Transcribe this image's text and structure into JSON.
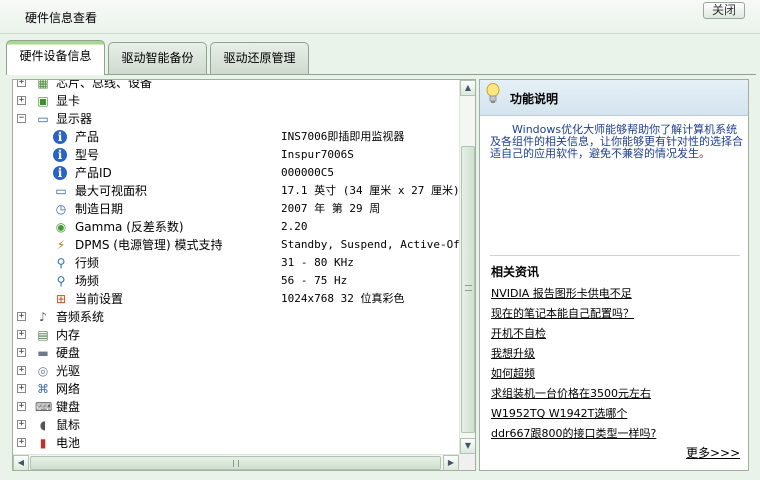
{
  "window": {
    "title": "硬件信息查看",
    "close_label": "关闭"
  },
  "tabs": [
    {
      "label": "硬件设备信息",
      "active": true
    },
    {
      "label": "驱动智能备份",
      "active": false
    },
    {
      "label": "驱动还原管理",
      "active": false
    }
  ],
  "tree": {
    "rows": [
      {
        "kind": "group",
        "label": "芯片、总线、设备",
        "expander": "+",
        "icon": "chip-icon",
        "glyph": "▦",
        "color": "#4a8a3a",
        "name": "tree-node-chipset"
      },
      {
        "kind": "group",
        "label": "显卡",
        "expander": "+",
        "icon": "graphics-card-icon",
        "glyph": "▣",
        "color": "#3f8f2f",
        "name": "tree-node-graphics-card"
      },
      {
        "kind": "group",
        "label": "显示器",
        "expander": "−",
        "icon": "monitor-icon",
        "glyph": "▭",
        "color": "#2d5fa8",
        "name": "tree-node-monitor"
      },
      {
        "kind": "prop",
        "label": "产品",
        "value": "INS7006即插即用监视器",
        "icon": "info-icon",
        "glyph": "i",
        "color": "#2258b8",
        "name": "prop-product"
      },
      {
        "kind": "prop",
        "label": "型号",
        "value": "Inspur7006S",
        "icon": "info-icon",
        "glyph": "i",
        "color": "#2258b8",
        "name": "prop-model"
      },
      {
        "kind": "prop",
        "label": "产品ID",
        "value": "000000C5",
        "icon": "info-icon",
        "glyph": "i",
        "color": "#2258b8",
        "name": "prop-product-id"
      },
      {
        "kind": "prop",
        "label": "最大可视面积",
        "value": "17.1 英寸 (34 厘米 x 27 厘米)",
        "icon": "monitor-icon",
        "glyph": "▭",
        "color": "#2d5fa8",
        "name": "prop-max-visible-area"
      },
      {
        "kind": "prop",
        "label": "制造日期",
        "value": "2007 年 第 29 周",
        "icon": "clock-icon",
        "glyph": "◷",
        "color": "#2d5fa8",
        "name": "prop-manufacture-date"
      },
      {
        "kind": "prop",
        "label": "Gamma (反差系数)",
        "value": "2.20",
        "icon": "gamma-icon",
        "glyph": "◉",
        "color": "#4a9a3a",
        "name": "prop-gamma"
      },
      {
        "kind": "prop",
        "label": "DPMS (电源管理) 模式支持",
        "value": "Standby, Suspend, Active-Off",
        "icon": "power-management-icon",
        "glyph": "⚡",
        "color": "#b07a20",
        "name": "prop-dpms"
      },
      {
        "kind": "prop",
        "label": "行频",
        "value": "31 - 80 KHz",
        "icon": "search-icon",
        "glyph": "⚲",
        "color": "#2a6fc0",
        "name": "prop-horizontal-frequency"
      },
      {
        "kind": "prop",
        "label": "场频",
        "value": "56 - 75 Hz",
        "icon": "search-icon",
        "glyph": "⚲",
        "color": "#2a6fc0",
        "name": "prop-vertical-frequency"
      },
      {
        "kind": "prop",
        "label": "当前设置",
        "value": "1024x768 32 位真彩色",
        "icon": "windows-logo-icon",
        "glyph": "⊞",
        "color": "#d04a1a",
        "name": "prop-current-settings"
      },
      {
        "kind": "group",
        "label": "音频系统",
        "expander": "+",
        "icon": "speaker-icon",
        "glyph": "♪",
        "color": "#555555",
        "name": "tree-node-audio"
      },
      {
        "kind": "group",
        "label": "内存",
        "expander": "+",
        "icon": "memory-icon",
        "glyph": "▤",
        "color": "#4a7a4a",
        "name": "tree-node-memory"
      },
      {
        "kind": "group",
        "label": "硬盘",
        "expander": "+",
        "icon": "hard-disk-icon",
        "glyph": "▬",
        "color": "#6a7a8a",
        "name": "tree-node-hard-disk"
      },
      {
        "kind": "group",
        "label": "光驱",
        "expander": "+",
        "icon": "optical-drive-icon",
        "glyph": "◎",
        "color": "#6a7a8a",
        "name": "tree-node-optical-drive"
      },
      {
        "kind": "group",
        "label": "网络",
        "expander": "+",
        "icon": "network-icon",
        "glyph": "⌘",
        "color": "#3a6ab0",
        "name": "tree-node-network"
      },
      {
        "kind": "group",
        "label": "键盘",
        "expander": "+",
        "icon": "keyboard-icon",
        "glyph": "⌨",
        "color": "#555555",
        "name": "tree-node-keyboard"
      },
      {
        "kind": "group",
        "label": "鼠标",
        "expander": "+",
        "icon": "mouse-icon",
        "glyph": "◖",
        "color": "#555555",
        "name": "tree-node-mouse"
      },
      {
        "kind": "group",
        "label": "电池",
        "expander": "+",
        "icon": "battery-icon",
        "glyph": "▮",
        "color": "#c03030",
        "name": "tree-node-battery"
      }
    ]
  },
  "side": {
    "title": "功能说明",
    "description": "Windows优化大师能够帮助你了解计算机系统及各组件的相关信息，让你能够更有针对性的选择合适自己的应用软件，避免不兼容的情况发生。",
    "news_title": "相关资讯",
    "news": [
      "NVIDIA 报告图形卡供电不足",
      "现在的笔记本能自己配置吗？",
      "开机不自检",
      "我想升级",
      "如何超频",
      "求组装机一台价格在3500元左右",
      "W1952TQ W1942T选哪个",
      "ddr667跟800的接口类型一样吗?"
    ],
    "more_label": "更多>>>"
  },
  "colors": {
    "accent_green": "#a8d890",
    "link_blue": "#1f3f8f",
    "panel_border": "#9fb09f"
  }
}
